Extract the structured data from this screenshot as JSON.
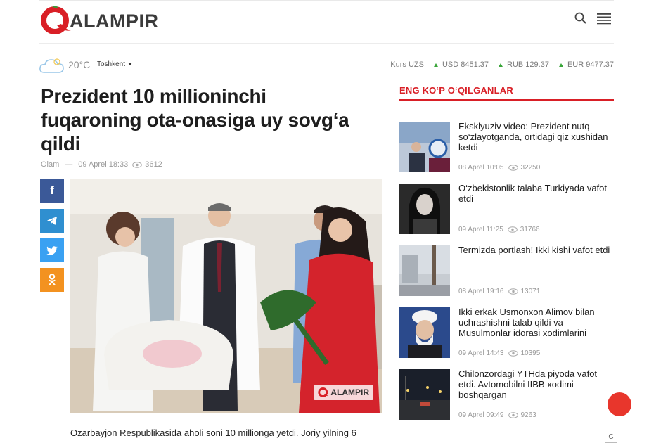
{
  "header": {
    "logo_text": "ALAMPIR"
  },
  "weather": {
    "temperature": "20°C",
    "city": "Toshkent"
  },
  "rates": {
    "label": "Kurs UZS",
    "items": [
      {
        "text": "USD 8451.37"
      },
      {
        "text": "RUB 129.37"
      },
      {
        "text": "EUR 9477.37"
      }
    ]
  },
  "article": {
    "title": "Prezident 10 millioninchi fuqaroning ota-onasiga uy sovg‘a qildi",
    "category": "Olam",
    "separator": "—",
    "date": "09 Aprel 18:33",
    "views": "3612",
    "photo_watermark": "ALAMPIR",
    "lead": "Ozarbayjon Respublikasida aholi soni 10 millionga yetdi. Joriy yilning 6"
  },
  "sidebar": {
    "title": "ENG KO‘P O‘QILGANLAR",
    "items": [
      {
        "title": "Eksklyuziv video: Prezident nutq so‘zlayotganda, ortidagi qiz xushidan ketdi",
        "date": "08 Aprel 10:05",
        "views": "32250"
      },
      {
        "title": "O‘zbekistonlik talaba Turkiyada vafot etdi",
        "date": "09 Aprel 11:25",
        "views": "31766"
      },
      {
        "title": "Termizda portlash! Ikki kishi vafot etdi",
        "date": "08 Aprel 19:16",
        "views": "13071"
      },
      {
        "title": "Ikki erkak Usmonxon Alimov bilan uchrashishni talab qildi va Musulmonlar idorasi xodimlarini",
        "date": "09 Aprel 14:43",
        "views": "10395"
      },
      {
        "title": "Chilonzordagi YTHda piyoda vafot etdi. Avtomobilni IIBB xodimi boshqargan",
        "date": "09 Aprel 09:49",
        "views": "9263"
      }
    ]
  },
  "corner_label": "C",
  "colors": {
    "brand_red": "#d91f26",
    "facebook": "#3b5998",
    "telegram": "#2f8fd0",
    "twitter": "#3aa1f2",
    "odnoklassniki": "#f39220"
  },
  "icons": [
    "q-logo-icon",
    "search-icon",
    "hamburger-menu-icon",
    "cloud-icon",
    "caret-down-icon",
    "arrow-up-icon",
    "eye-icon",
    "facebook-icon",
    "telegram-icon",
    "twitter-icon",
    "odnoklassniki-icon"
  ]
}
